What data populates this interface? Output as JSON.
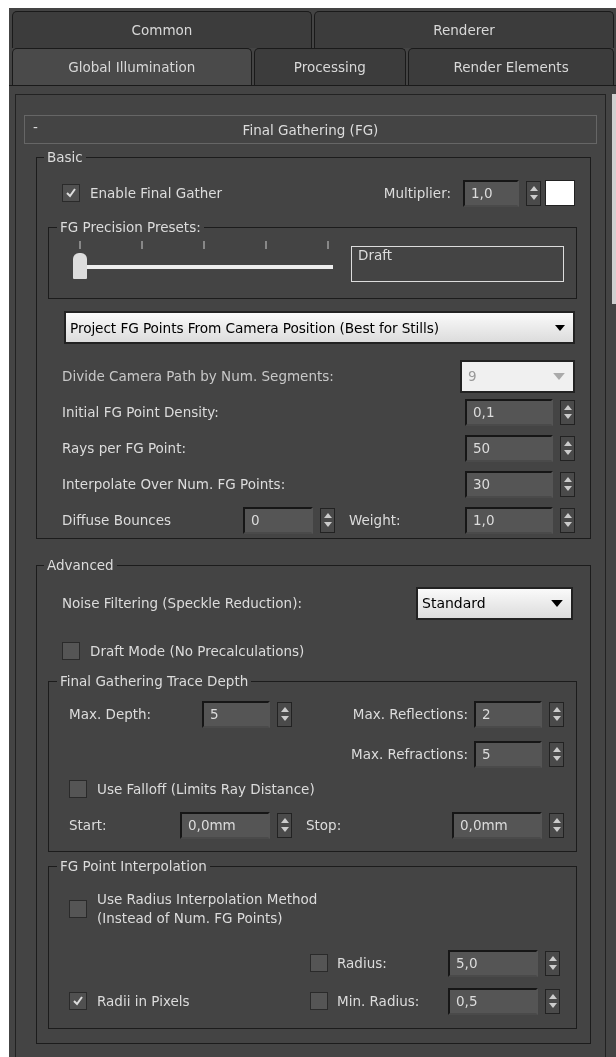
{
  "tabs": [
    [
      {
        "label": "Common",
        "selected": false
      },
      {
        "label": "Renderer",
        "selected": false
      }
    ],
    [
      {
        "label": "Global Illumination",
        "selected": true
      },
      {
        "label": "Processing",
        "selected": false
      },
      {
        "label": "Render Elements",
        "selected": false
      }
    ]
  ],
  "rollout": {
    "toggle": "-",
    "title": "Final Gathering (FG)",
    "expanded": true
  },
  "basic": {
    "label": "Basic",
    "enable": {
      "label": "Enable Final Gather",
      "checked": true
    },
    "multiplier": {
      "label": "Multiplier:",
      "value": "1,0",
      "color": "#ffffff"
    },
    "presets": {
      "label": "FG Precision Presets:",
      "level": 0,
      "value": "Draft"
    },
    "mode": {
      "value": "Project FG Points From Camera Position (Best for Stills)"
    },
    "rows": [
      {
        "kind": "combo",
        "label": "Divide Camera Path by Num. Segments:",
        "value": "9",
        "disabled": true
      },
      {
        "kind": "spinner",
        "label": "Initial FG Point Density:",
        "value": "0,1"
      },
      {
        "kind": "spinner",
        "label": "Rays per FG Point:",
        "value": "50"
      },
      {
        "kind": "spinner",
        "label": "Interpolate Over Num. FG Points:",
        "value": "30"
      },
      {
        "kind": "pair",
        "label": "Diffuse Bounces",
        "value": "0",
        "label2": "Weight:",
        "value2": "1,0"
      }
    ]
  },
  "advanced": {
    "label": "Advanced",
    "noise": {
      "label": "Noise Filtering (Speckle Reduction):",
      "value": "Standard"
    },
    "draft_mode": {
      "label": "Draft Mode (No Precalculations)",
      "checked": false
    },
    "trace": {
      "label": "Final Gathering Trace Depth",
      "max_depth": {
        "label": "Max. Depth:",
        "value": "5"
      },
      "reflections": {
        "label": "Max. Reflections:",
        "value": "2"
      },
      "refractions": {
        "label": "Max. Refractions:",
        "value": "5"
      },
      "falloff": {
        "label": "Use Falloff (Limits Ray Distance)",
        "checked": false
      },
      "start": {
        "label": "Start:",
        "value": "0,0mm"
      },
      "stop": {
        "label": "Stop:",
        "value": "0,0mm"
      }
    },
    "interpolation": {
      "label": "FG Point Interpolation",
      "use_radius": {
        "label_lines": [
          "Use Radius Interpolation Method",
          "(Instead of Num. FG Points)"
        ],
        "checked": false
      },
      "radius": {
        "label": "Radius:",
        "value": "5,0",
        "checked": false
      },
      "radii_in_pixels": {
        "label": "Radii in Pixels",
        "checked": true
      },
      "min_radius": {
        "label": "Min. Radius:",
        "value": "0,5",
        "checked": false
      }
    }
  }
}
